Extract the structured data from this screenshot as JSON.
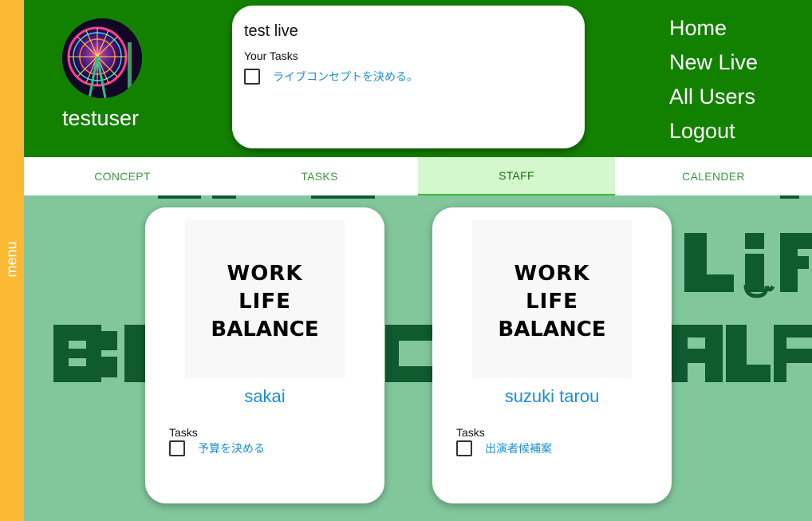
{
  "side_menu": {
    "label": "menu"
  },
  "header": {
    "username": "testuser",
    "live_card": {
      "title": "test live",
      "tasks_heading": "Your Tasks",
      "tasks": [
        {
          "label": "ライブコンセプトを決める。",
          "checked": false
        }
      ]
    },
    "nav": [
      {
        "label": "Home"
      },
      {
        "label": "New Live"
      },
      {
        "label": "All Users"
      },
      {
        "label": "Logout"
      }
    ]
  },
  "tabs": [
    {
      "label": "CONCEPT",
      "active": false
    },
    {
      "label": "TASKS",
      "active": false
    },
    {
      "label": "STAFF",
      "active": true
    },
    {
      "label": "CALENDER",
      "active": false
    }
  ],
  "staff": [
    {
      "logo_lines": [
        "WORK",
        "LIFE",
        "BALANCE"
      ],
      "name": "sakai",
      "tasks_heading": "Tasks",
      "tasks": [
        {
          "label": "予算を決める",
          "checked": false
        }
      ]
    },
    {
      "logo_lines": [
        "WORK",
        "LIFE",
        "BALANCE"
      ],
      "name": "suzuki tarou",
      "tasks_heading": "Tasks",
      "tasks": [
        {
          "label": "出演者候補案",
          "checked": false
        }
      ]
    }
  ],
  "colors": {
    "header_bg": "#138100",
    "side_menu_bg": "#fbb833",
    "page_bg": "#82c79c",
    "active_tab_bg": "#d5f7cd",
    "link": "#1a8ed3",
    "watermark": "#0f5a2e"
  }
}
